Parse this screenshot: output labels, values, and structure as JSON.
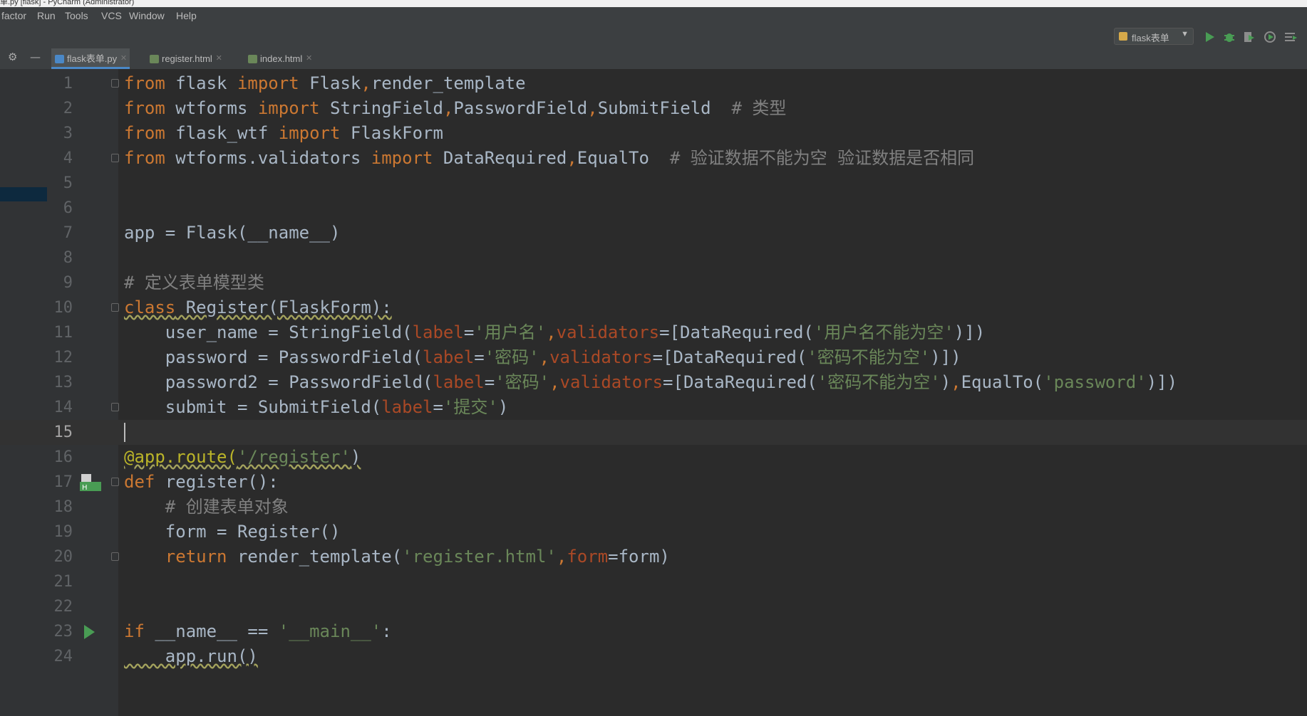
{
  "window": {
    "title": "单.py [flask] - PyCharm (Administrator)"
  },
  "menu": [
    "factor",
    "Run",
    "Tools",
    "VCS",
    "Window",
    "Help"
  ],
  "toolbar": {
    "run_config": "flask表单",
    "icons": [
      "run-icon",
      "debug-icon",
      "coverage-icon",
      "profile-icon",
      "concurrency-icon"
    ]
  },
  "tabs": [
    {
      "label": "flask表单.py",
      "active": true,
      "icon": "python-file-icon"
    },
    {
      "label": "register.html",
      "active": false,
      "icon": "html-file-icon"
    },
    {
      "label": "index.html",
      "active": false,
      "icon": "html-file-icon"
    }
  ],
  "editor": {
    "current_line": 15,
    "lines": [
      {
        "n": "1",
        "tokens": [
          {
            "t": "from",
            "c": "kw"
          },
          {
            "t": " flask "
          },
          {
            "t": "import",
            "c": "kw"
          },
          {
            "t": " Flask"
          },
          {
            "t": ",",
            "c": "kw"
          },
          {
            "t": "render_template"
          }
        ]
      },
      {
        "n": "2",
        "tokens": [
          {
            "t": "from",
            "c": "kw"
          },
          {
            "t": " wtforms "
          },
          {
            "t": "import",
            "c": "kw"
          },
          {
            "t": " StringField"
          },
          {
            "t": ",",
            "c": "kw"
          },
          {
            "t": "PasswordField"
          },
          {
            "t": ",",
            "c": "kw"
          },
          {
            "t": "SubmitField  "
          },
          {
            "t": "# 类型",
            "c": "cm"
          }
        ]
      },
      {
        "n": "3",
        "tokens": [
          {
            "t": "from",
            "c": "kw"
          },
          {
            "t": " flask_wtf "
          },
          {
            "t": "import",
            "c": "kw"
          },
          {
            "t": " FlaskForm"
          }
        ]
      },
      {
        "n": "4",
        "tokens": [
          {
            "t": "from",
            "c": "kw"
          },
          {
            "t": " wtforms.validators "
          },
          {
            "t": "import",
            "c": "kw"
          },
          {
            "t": " DataRequired"
          },
          {
            "t": ",",
            "c": "kw"
          },
          {
            "t": "EqualTo  "
          },
          {
            "t": "# 验证数据不能为空 验证数据是否相同",
            "c": "cm"
          }
        ]
      },
      {
        "n": "5",
        "tokens": []
      },
      {
        "n": "6",
        "tokens": []
      },
      {
        "n": "7",
        "tokens": [
          {
            "t": "app = Flask(__name__)"
          }
        ]
      },
      {
        "n": "8",
        "tokens": []
      },
      {
        "n": "9",
        "tokens": [
          {
            "t": "# 定义表单模型类",
            "c": "cm"
          }
        ]
      },
      {
        "n": "10",
        "tokens": [
          {
            "t": "class",
            "c": "kw wavy"
          },
          {
            "t": " Register(FlaskForm):",
            "c": "wavy"
          }
        ]
      },
      {
        "n": "11",
        "tokens": [
          {
            "t": "    user_name = StringField("
          },
          {
            "t": "label",
            "c": "prm"
          },
          {
            "t": "="
          },
          {
            "t": "'用户名'",
            "c": "str"
          },
          {
            "t": ",",
            "c": "kw"
          },
          {
            "t": "validators",
            "c": "prm"
          },
          {
            "t": "=[DataRequired("
          },
          {
            "t": "'用户名不能为空'",
            "c": "str"
          },
          {
            "t": ")])"
          }
        ]
      },
      {
        "n": "12",
        "tokens": [
          {
            "t": "    password = PasswordField("
          },
          {
            "t": "label",
            "c": "prm"
          },
          {
            "t": "="
          },
          {
            "t": "'密码'",
            "c": "str"
          },
          {
            "t": ",",
            "c": "kw"
          },
          {
            "t": "validators",
            "c": "prm"
          },
          {
            "t": "=[DataRequired("
          },
          {
            "t": "'密码不能为空'",
            "c": "str"
          },
          {
            "t": ")])"
          }
        ]
      },
      {
        "n": "13",
        "tokens": [
          {
            "t": "    password2 = PasswordField("
          },
          {
            "t": "label",
            "c": "prm"
          },
          {
            "t": "="
          },
          {
            "t": "'密码'",
            "c": "str"
          },
          {
            "t": ",",
            "c": "kw"
          },
          {
            "t": "validators",
            "c": "prm"
          },
          {
            "t": "=[DataRequired("
          },
          {
            "t": "'密码不能为空'",
            "c": "str"
          },
          {
            "t": ")"
          },
          {
            "t": ",",
            "c": "kw"
          },
          {
            "t": "EqualTo("
          },
          {
            "t": "'password'",
            "c": "str"
          },
          {
            "t": ")])"
          }
        ]
      },
      {
        "n": "14",
        "tokens": [
          {
            "t": "    submit = SubmitField("
          },
          {
            "t": "label",
            "c": "prm"
          },
          {
            "t": "="
          },
          {
            "t": "'提交'",
            "c": "str"
          },
          {
            "t": ")"
          }
        ]
      },
      {
        "n": "15",
        "tokens": []
      },
      {
        "n": "16",
        "tokens": [
          {
            "t": "@app.route(",
            "c": "deco wavy"
          },
          {
            "t": "'/register'",
            "c": "str wavy"
          },
          {
            "t": ")",
            "c": "wavy"
          }
        ]
      },
      {
        "n": "17",
        "tokens": [
          {
            "t": "def",
            "c": "kw"
          },
          {
            "t": " register():"
          }
        ]
      },
      {
        "n": "18",
        "tokens": [
          {
            "t": "    "
          },
          {
            "t": "# 创建表单对象",
            "c": "cm"
          }
        ]
      },
      {
        "n": "19",
        "tokens": [
          {
            "t": "    form = Register()"
          }
        ]
      },
      {
        "n": "20",
        "tokens": [
          {
            "t": "    "
          },
          {
            "t": "return",
            "c": "kw"
          },
          {
            "t": " render_template("
          },
          {
            "t": "'register.html'",
            "c": "str"
          },
          {
            "t": ",",
            "c": "kw"
          },
          {
            "t": "form",
            "c": "prm"
          },
          {
            "t": "=form)"
          }
        ]
      },
      {
        "n": "21",
        "tokens": []
      },
      {
        "n": "22",
        "tokens": []
      },
      {
        "n": "23",
        "tokens": [
          {
            "t": "if",
            "c": "kw"
          },
          {
            "t": " __name__ == "
          },
          {
            "t": "'__main__'",
            "c": "str"
          },
          {
            "t": ":"
          }
        ]
      },
      {
        "n": "24",
        "tokens": [
          {
            "t": "    app.run()",
            "c": "wavy"
          }
        ]
      }
    ],
    "fold_lines": [
      1,
      4,
      10,
      14,
      17,
      20
    ],
    "gutter_markers": [
      {
        "line": 17,
        "icon": "html-template-icon"
      },
      {
        "line": 23,
        "icon": "run-arrow-icon"
      }
    ]
  },
  "colors": {
    "editor_bg": "#2b2b2b",
    "keyword": "#cc7832",
    "string": "#6a8759",
    "comment": "#808080",
    "param": "#aa4926",
    "decorator": "#bbb529",
    "text": "#a9b7c6"
  }
}
